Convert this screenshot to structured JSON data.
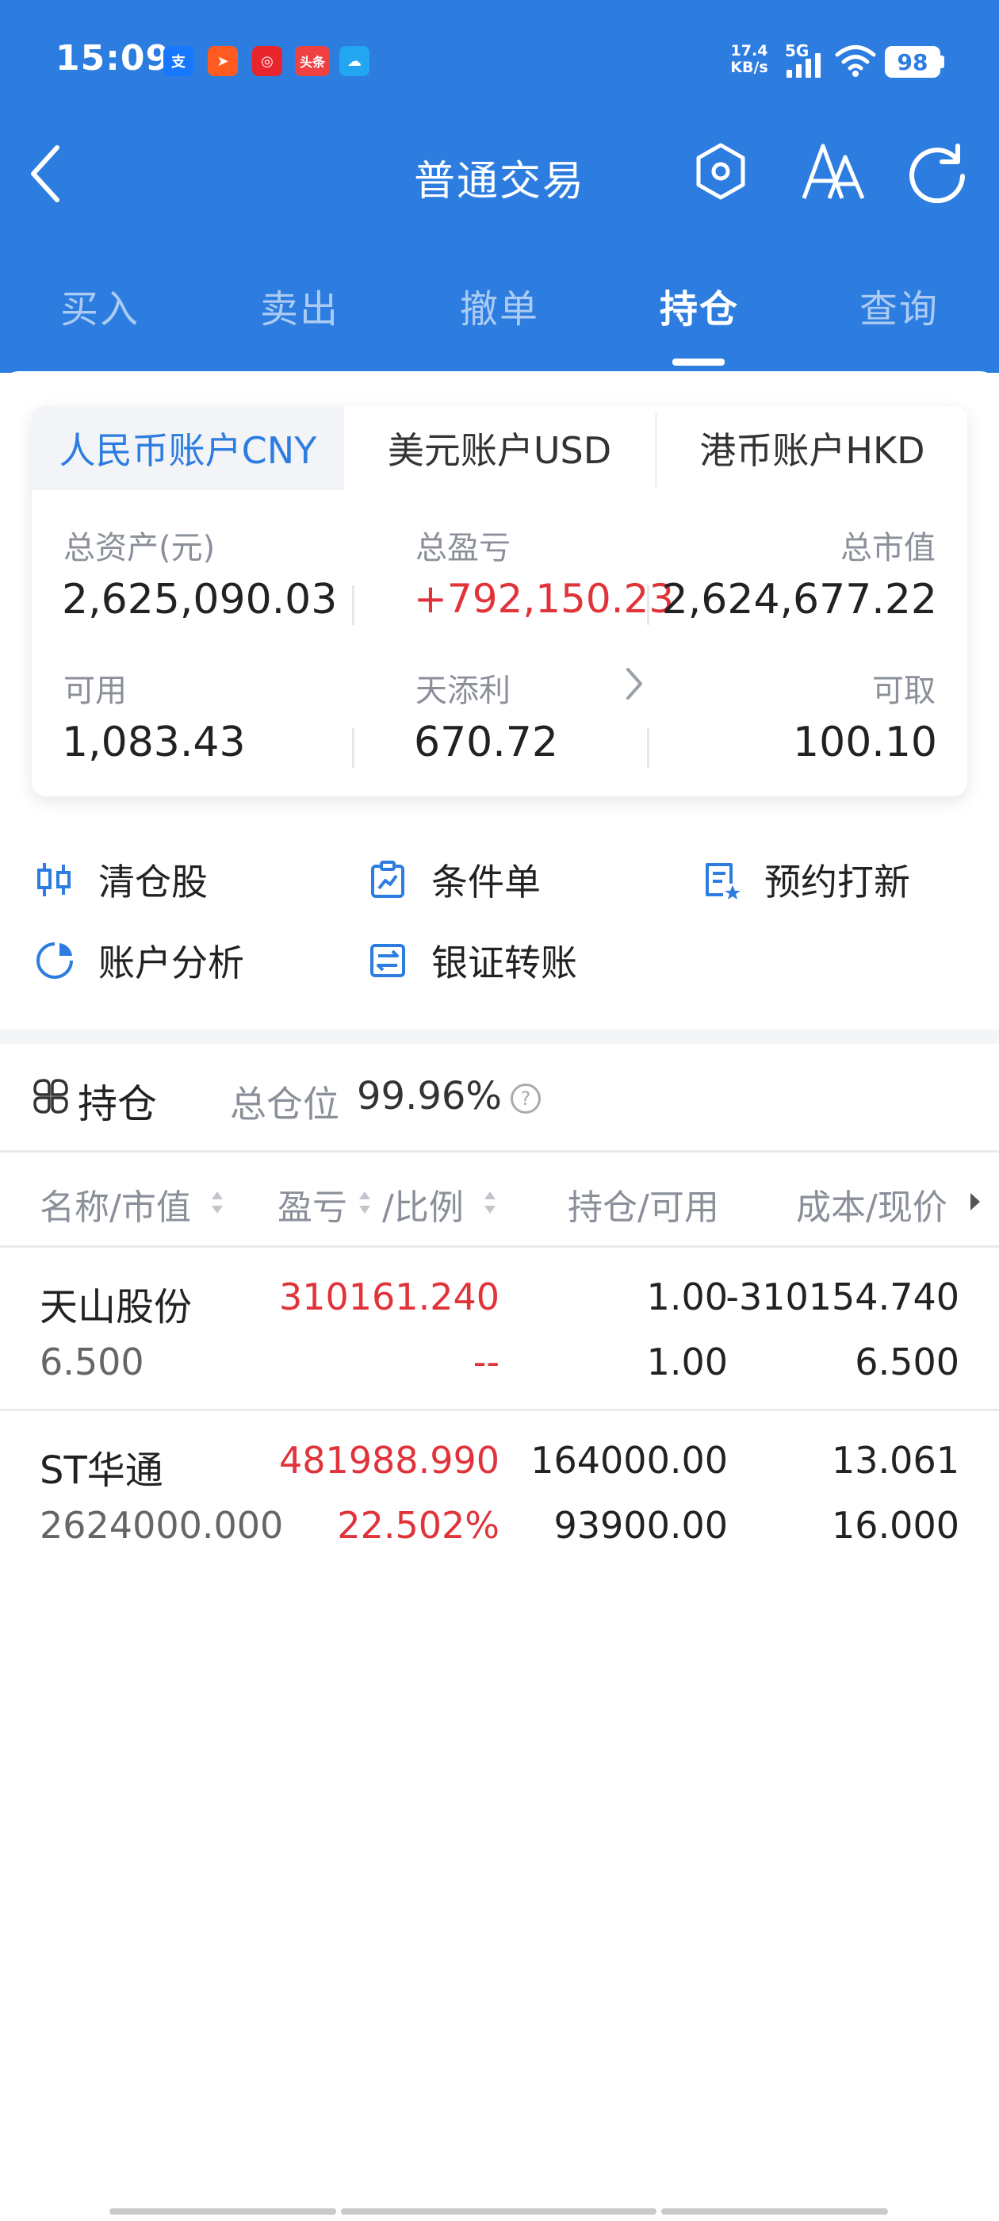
{
  "status_bar": {
    "time": "15:09",
    "apps": [
      {
        "icon": "alipay-icon",
        "glyph": "支",
        "color": "#1677ff"
      },
      {
        "icon": "arrow-app-icon",
        "glyph": "➤",
        "color": "#ff5a1f"
      },
      {
        "icon": "red-app-icon",
        "glyph": "◎",
        "color": "#e8242c"
      },
      {
        "icon": "toutiao-icon",
        "glyph": "头条",
        "color": "#f04142"
      },
      {
        "icon": "cloud-app-icon",
        "glyph": "☁",
        "color": "#22a6f2"
      }
    ],
    "net_speed_value": "17.4",
    "net_speed_unit": "KB/s",
    "network": "5G",
    "battery": "98"
  },
  "header": {
    "title": "普通交易"
  },
  "tabs": [
    {
      "label": "买入"
    },
    {
      "label": "卖出"
    },
    {
      "label": "撤单"
    },
    {
      "label": "持仓",
      "active": true
    },
    {
      "label": "查询"
    }
  ],
  "account_tabs": [
    {
      "label": "人民币账户CNY",
      "active": true
    },
    {
      "label": "美元账户USD"
    },
    {
      "label": "港币账户HKD"
    }
  ],
  "summary": {
    "total_assets_label": "总资产(元)",
    "total_assets": "2,625,090.03",
    "total_pl_label": "总盈亏",
    "total_pl": "+792,150.23",
    "market_value_label": "总市值",
    "market_value": "2,624,677.22",
    "available_label": "可用",
    "available": "1,083.43",
    "tiantianli_label": "天添利",
    "tiantianli": "670.72",
    "withdrawable_label": "可取",
    "withdrawable": "100.10"
  },
  "quick_actions": [
    {
      "label": "清仓股",
      "icon": "clear-stock-icon"
    },
    {
      "label": "条件单",
      "icon": "condition-order-icon"
    },
    {
      "label": "预约打新",
      "icon": "ipo-reserve-icon"
    },
    {
      "label": "账户分析",
      "icon": "account-analysis-icon"
    },
    {
      "label": "银证转账",
      "icon": "bank-transfer-icon"
    }
  ],
  "holdings": {
    "title": "持仓",
    "total_position_label": "总仓位",
    "total_position": "99.96%",
    "headers": [
      "名称/市值",
      "盈亏",
      "/比例",
      "持仓/可用",
      "成本/现价"
    ],
    "rows": [
      {
        "name": "天山股份",
        "market_value": "6.500",
        "pl": "310161.240",
        "ratio": "--",
        "position": "1.00",
        "available": "1.00",
        "cost": "-310154.740",
        "price": "6.500"
      },
      {
        "name": "ST华通",
        "market_value": "2624000.000",
        "pl": "481988.990",
        "ratio": "22.502%",
        "position": "164000.00",
        "available": "93900.00",
        "cost": "13.061",
        "price": "16.000"
      }
    ]
  },
  "colors": {
    "primary": "#2d7de0",
    "profit_red": "#e0333a",
    "muted_text": "#8a8f99"
  }
}
